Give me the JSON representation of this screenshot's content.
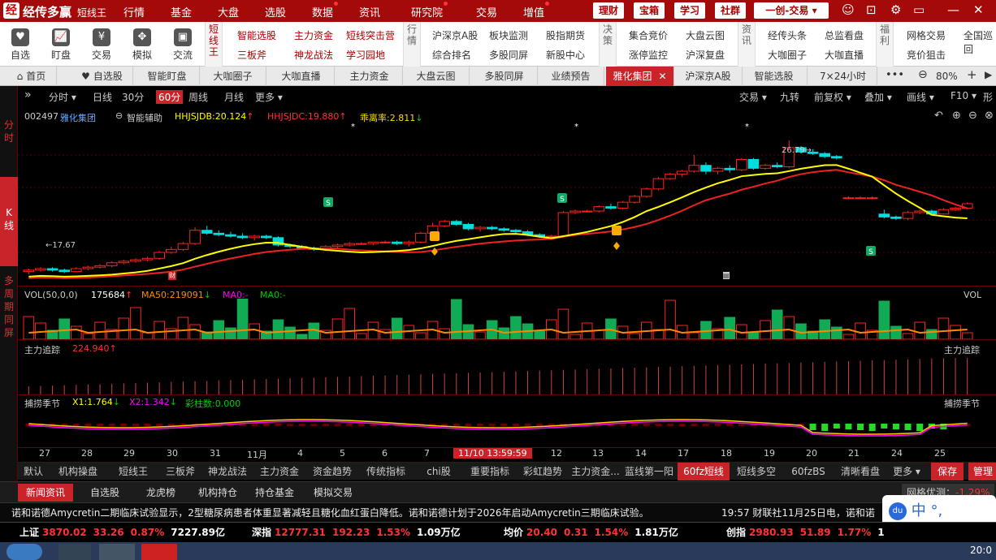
{
  "app": {
    "logo": "经",
    "name": "经传多赢",
    "sub": "短线王"
  },
  "menu": [
    {
      "label": "行情",
      "dot": false
    },
    {
      "label": "基金",
      "dot": false
    },
    {
      "label": "大盘",
      "dot": false
    },
    {
      "label": "选股",
      "dot": false
    },
    {
      "label": "数据",
      "dot": true
    },
    {
      "label": "资讯",
      "dot": false
    },
    {
      "label": "研究院",
      "dot": true
    },
    {
      "label": "交易",
      "dot": false
    },
    {
      "label": "增值",
      "dot": true
    }
  ],
  "title_buttons": [
    "理财",
    "宝箱",
    "学习",
    "社群",
    "一创-交易"
  ],
  "toolbar": {
    "tools": [
      {
        "label": "自选",
        "icon": "heart-icon"
      },
      {
        "label": "盯盘",
        "icon": "chart-icon"
      },
      {
        "label": "交易",
        "icon": "yen-icon"
      },
      {
        "label": "模拟",
        "icon": "gamepad-icon"
      },
      {
        "label": "交流",
        "icon": "chat-icon"
      }
    ],
    "group1_tab": "短线王",
    "group1": [
      "智能选股",
      "主力资金",
      "短线突击营",
      "三板斧",
      "神龙战法",
      "学习园地"
    ],
    "group2_tab": "行情",
    "group2": [
      "沪深京A股",
      "板块监测",
      "股指期货",
      "综合排名",
      "多股同屏",
      "新股中心"
    ],
    "group3_tab": "决策",
    "group3": [
      "集合竞价",
      "大盘云图",
      "涨停监控",
      "沪深复盘"
    ],
    "group4_tab": "资讯",
    "group4": [
      "经传头条",
      "总监看盘",
      "大咖圈子",
      "大咖直播"
    ],
    "group5_tab": "福利",
    "group5": [
      "网格交易",
      "全国巡回",
      "竞价狙击"
    ]
  },
  "tabs": [
    "首页",
    "自选股",
    "智能盯盘",
    "大咖圈子",
    "大咖直播",
    "主力资金",
    "大盘云图",
    "多股同屏",
    "业绩预告",
    "雅化集团",
    "沪深京A股",
    "智能选股",
    "7×24小时"
  ],
  "active_tab": "雅化集团",
  "zoom": "80%",
  "left_side": [
    "分时",
    "K线",
    "多周期同屏"
  ],
  "periods": [
    "分时",
    "日线",
    "30分",
    "60分",
    "周线",
    "月线",
    "更多"
  ],
  "active_period": "60分",
  "right_buttons": [
    "交易",
    "九转",
    "前复权",
    "叠加",
    "画线",
    "F10",
    "形"
  ],
  "stock": {
    "code": "002497",
    "name": "雅化集团",
    "assist": "智能辅助",
    "hhjsjdb": "HHJSJDB:20.124",
    "hhjsjdc": "HHJSJDC:19.880",
    "ratio": "乖离率:2.811"
  },
  "price_labels": {
    "low": "17.67",
    "high": "26.79"
  },
  "vol_legend": {
    "vol": "VOL(50,0,0)",
    "val": "175684",
    "ma50": "MA50:219091",
    "ma0a": "MA0:-",
    "ma0b": "MA0:-",
    "right": "VOL"
  },
  "main_force": {
    "label": "主力追踪",
    "value": "224.940",
    "right": "主力追踪"
  },
  "season": {
    "label": "捕捞季节",
    "x1": "X1:1.764",
    "x2": "X2:1.342",
    "color": "彩柱数:0.000",
    "right": "捕捞季节"
  },
  "x_axis": [
    "27",
    "28",
    "29",
    "30",
    "31",
    "11月",
    "4",
    "5",
    "6",
    "7",
    "11/10 13:59:59",
    "12",
    "13",
    "14",
    "17",
    "18",
    "19",
    "20",
    "21",
    "24",
    "25"
  ],
  "bottom_tabs": [
    "默认",
    "机构操盘",
    "短线王",
    "三板斧",
    "神龙战法",
    "主力资金",
    "资金趋势",
    "传统指标",
    "chi股",
    "重要指标",
    "彩虹趋势",
    "主力资金...",
    "蓝线第一阳",
    "60fz短线",
    "短线多空",
    "60fzBS",
    "清晰看盘",
    "更多",
    "保存",
    "管理"
  ],
  "active_bottom": "60fz短线",
  "news_tabs": [
    "新闻资讯",
    "自选股",
    "龙虎榜",
    "机构持仓",
    "持仓基金",
    "模拟交易"
  ],
  "grid_opt": {
    "label": "网格优测：",
    "value": "-1.29%"
  },
  "ticker": "诺和诺德Amycretin二期临床试验显示，2型糖尿病患者体重显著减轻且糖化血红蛋白降低。诺和诺德计划于2026年启动Amycretin三期临床试验。",
  "ticker2": "19:57 财联社11月25日电，诺和诺",
  "indices": [
    {
      "name": "上证",
      "v1": "3870.02",
      "v2": "33.26",
      "v3": "0.87%",
      "v4": "7227.89亿"
    },
    {
      "name": "深指",
      "v1": "12777.31",
      "v2": "192.23",
      "v3": "1.53%",
      "v4": "1.09万亿"
    },
    {
      "name": "均价",
      "v1": "20.40",
      "v2": "0.31",
      "v3": "1.54%",
      "v4": "1.81万亿"
    },
    {
      "name": "创指",
      "v1": "2980.93",
      "v2": "51.89",
      "v3": "1.77%",
      "v4": "1"
    }
  ],
  "ime": {
    "label": "中",
    "punct": "°,"
  },
  "taskbar_time": "20:0",
  "chart_data": {
    "type": "candlestick",
    "ohlc": [
      [
        17.9,
        18.1,
        17.7,
        18.0
      ],
      [
        18.0,
        18.2,
        17.9,
        18.1
      ],
      [
        18.1,
        18.2,
        17.9,
        18.0
      ],
      [
        18.0,
        18.1,
        17.8,
        17.9
      ],
      [
        17.9,
        18.2,
        17.9,
        18.1
      ],
      [
        18.1,
        18.3,
        18.0,
        18.2
      ],
      [
        18.2,
        18.4,
        18.1,
        18.3
      ],
      [
        18.3,
        18.6,
        18.2,
        18.5
      ],
      [
        18.5,
        18.7,
        18.4,
        18.6
      ],
      [
        18.6,
        18.8,
        18.5,
        18.7
      ],
      [
        18.7,
        18.9,
        18.6,
        18.8
      ],
      [
        18.8,
        19.3,
        18.7,
        19.2
      ],
      [
        19.2,
        19.6,
        19.1,
        19.4
      ],
      [
        19.4,
        19.9,
        19.3,
        19.8
      ],
      [
        19.8,
        20.9,
        19.7,
        20.7
      ],
      [
        20.7,
        21.0,
        20.4,
        20.5
      ],
      [
        20.5,
        20.7,
        20.3,
        20.4
      ],
      [
        20.4,
        20.6,
        20.2,
        20.3
      ],
      [
        20.3,
        20.5,
        20.1,
        20.2
      ],
      [
        20.2,
        20.4,
        20.0,
        20.3
      ],
      [
        20.3,
        20.4,
        20.1,
        20.2
      ],
      [
        20.2,
        20.3,
        19.6,
        19.7
      ],
      [
        19.7,
        19.8,
        19.5,
        19.6
      ],
      [
        19.6,
        19.7,
        19.4,
        19.5
      ],
      [
        19.5,
        19.6,
        19.3,
        19.4
      ],
      [
        19.4,
        19.7,
        19.3,
        19.6
      ],
      [
        19.6,
        19.8,
        19.5,
        19.7
      ],
      [
        19.7,
        19.9,
        19.6,
        19.8
      ],
      [
        19.8,
        19.9,
        19.7,
        19.8
      ],
      [
        19.8,
        19.9,
        19.7,
        19.9
      ],
      [
        19.9,
        20.0,
        19.8,
        19.9
      ],
      [
        19.9,
        20.0,
        19.7,
        19.8
      ],
      [
        19.8,
        20.0,
        19.6,
        19.9
      ],
      [
        19.9,
        20.6,
        19.8,
        20.5
      ],
      [
        20.5,
        21.2,
        20.4,
        21.0
      ],
      [
        21.0,
        21.4,
        20.9,
        21.3
      ],
      [
        21.3,
        21.4,
        21.0,
        21.1
      ],
      [
        21.1,
        21.2,
        20.7,
        20.8
      ],
      [
        20.8,
        21.0,
        20.6,
        20.9
      ],
      [
        20.9,
        21.0,
        20.7,
        20.8
      ],
      [
        20.8,
        20.9,
        20.6,
        20.7
      ],
      [
        20.7,
        20.8,
        20.5,
        20.6
      ],
      [
        20.6,
        20.7,
        20.3,
        20.4
      ],
      [
        20.4,
        20.5,
        20.2,
        20.3
      ],
      [
        20.3,
        20.4,
        20.2,
        20.3
      ],
      [
        20.3,
        22.0,
        20.2,
        21.9
      ],
      [
        21.9,
        22.1,
        21.8,
        22.0
      ],
      [
        22.0,
        22.1,
        21.9,
        22.0
      ],
      [
        22.0,
        22.4,
        21.9,
        22.3
      ],
      [
        22.3,
        22.5,
        22.1,
        22.2
      ],
      [
        22.2,
        22.7,
        22.1,
        22.6
      ],
      [
        22.6,
        23.1,
        22.5,
        23.0
      ],
      [
        23.0,
        23.6,
        22.9,
        23.5
      ],
      [
        23.5,
        24.3,
        23.4,
        24.2
      ],
      [
        24.2,
        24.6,
        24.1,
        24.5
      ],
      [
        24.5,
        24.8,
        24.3,
        24.7
      ],
      [
        24.7,
        25.8,
        24.6,
        25.1
      ],
      [
        25.1,
        25.3,
        24.5,
        24.7
      ],
      [
        24.7,
        25.0,
        24.5,
        24.9
      ],
      [
        24.9,
        25.1,
        24.6,
        24.8
      ],
      [
        24.8,
        25.6,
        24.7,
        25.5
      ],
      [
        25.5,
        25.6,
        24.8,
        24.9
      ],
      [
        24.9,
        25.2,
        24.8,
        25.1
      ],
      [
        25.1,
        25.3,
        24.9,
        25.0
      ],
      [
        25.0,
        26.79,
        24.9,
        26.3
      ],
      [
        26.3,
        26.4,
        25.9,
        26.0
      ],
      [
        26.0,
        26.2,
        25.8,
        25.9
      ],
      [
        25.9,
        26.0,
        25.6,
        25.7
      ],
      [
        25.7,
        25.8,
        25.5,
        25.6
      ],
      [
        22.9,
        23.0,
        22.8,
        22.9
      ],
      [
        22.9,
        23.0,
        22.8,
        22.9
      ],
      [
        22.9,
        23.0,
        22.8,
        22.9
      ],
      [
        21.8,
        22.1,
        21.5,
        21.6
      ],
      [
        21.6,
        21.7,
        21.4,
        21.5
      ],
      [
        21.5,
        22.0,
        21.4,
        21.9
      ],
      [
        21.9,
        22.1,
        21.8,
        22.0
      ],
      [
        22.0,
        22.1,
        21.7,
        21.8
      ],
      [
        21.8,
        22.2,
        21.8,
        22.1
      ],
      [
        22.1,
        22.3,
        22.0,
        22.2
      ],
      [
        22.2,
        22.6,
        22.1,
        22.5
      ]
    ],
    "y_range": [
      17.0,
      28.0
    ]
  }
}
